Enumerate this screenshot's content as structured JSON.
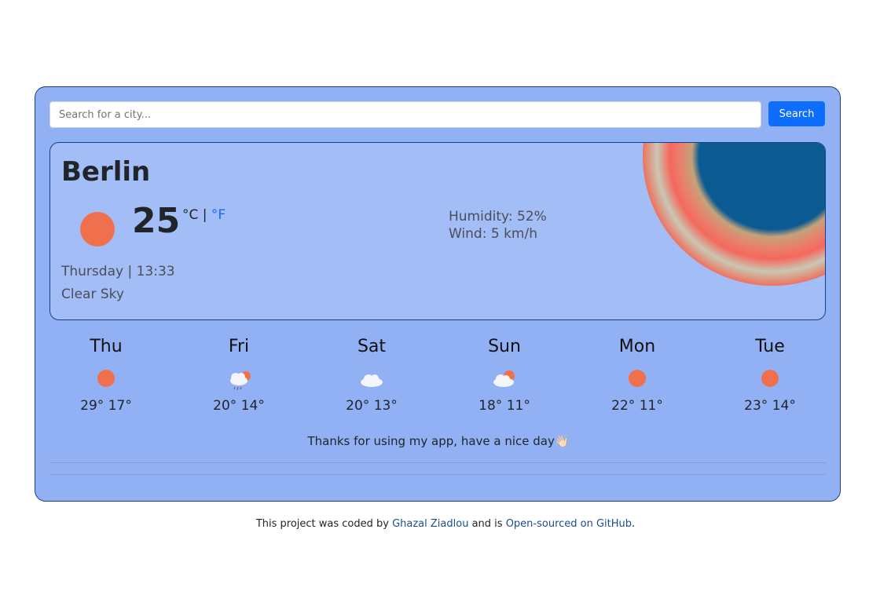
{
  "search": {
    "placeholder": "Search for a city...",
    "button_label": "Search"
  },
  "current": {
    "city": "Berlin",
    "temperature": "25",
    "unit_c": "°C",
    "unit_separator": " | ",
    "unit_f": "°F",
    "date_time": "Thursday | 13:33",
    "description": "Clear Sky",
    "humidity": "Humidity: 52%",
    "wind": "Wind: 5 km/h",
    "icon": "sun-icon"
  },
  "forecast": [
    {
      "day": "Thu",
      "temps": "29° 17°",
      "icon": "sun-icon"
    },
    {
      "day": "Fri",
      "temps": "20° 14°",
      "icon": "rain-cloud-sun-icon"
    },
    {
      "day": "Sat",
      "temps": "20° 13°",
      "icon": "cloud-icon"
    },
    {
      "day": "Sun",
      "temps": "18° 11°",
      "icon": "cloud-sun-icon"
    },
    {
      "day": "Mon",
      "temps": "22° 11°",
      "icon": "sun-icon"
    },
    {
      "day": "Tue",
      "temps": "23° 14°",
      "icon": "sun-icon"
    }
  ],
  "thanks": "Thanks for using my app, have a nice day👋🏻",
  "footer": {
    "prefix": "This project was coded by ",
    "author_link": "Ghazal Ziadlou",
    "middle": " and is ",
    "repo_link": "Open-sourced on GitHub",
    "suffix": "."
  },
  "colors": {
    "app_background": "#92b1f4",
    "card_background": "#a3bdf7",
    "sun": "#f0704e",
    "accent": "#0d6efd"
  }
}
